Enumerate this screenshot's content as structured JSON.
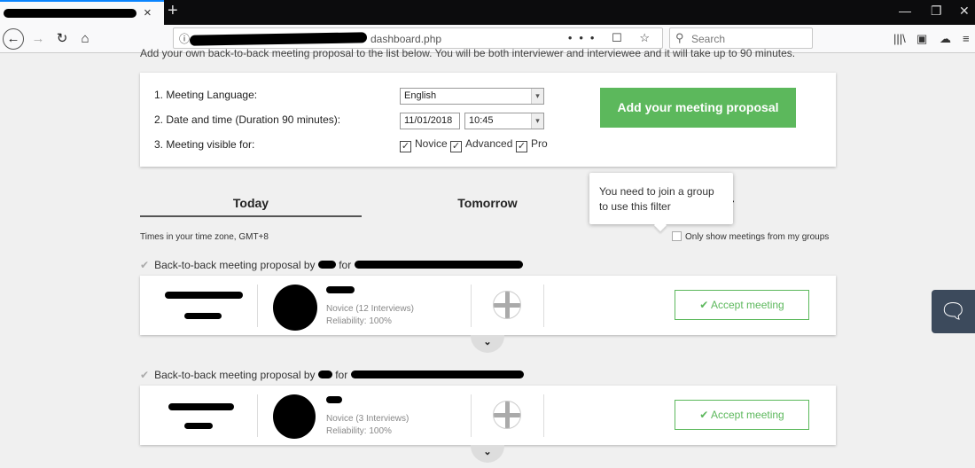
{
  "browser": {
    "tab_close": "×",
    "new_tab": "+",
    "url_suffix": "dashboard.php",
    "url_actions": "••• ☐ ☆",
    "search_placeholder": "Search"
  },
  "intro_text": "Add your own back-to-back meeting proposal to the list below. You will be both interviewer and interviewee and it will take up to 90 minutes.",
  "form": {
    "language_label": "1. Meeting Language:",
    "language_value": "English",
    "datetime_label": "2. Date and time (Duration 90 minutes):",
    "date_value": "11/01/2018",
    "time_value": "10:45",
    "visible_label": "3. Meeting visible for:",
    "levels": [
      "Novice",
      "Advanced",
      "Pro"
    ],
    "add_button": "Add your meeting proposal"
  },
  "tabs": [
    "Today",
    "Tomorrow",
    "er"
  ],
  "tooltip": "You need to join a group to use this filter",
  "timezone_note": "Times in your time zone, GMT+8",
  "group_filter_label": "Only show meetings from my groups",
  "meetings": [
    {
      "header_prefix": "Back-to-back meeting proposal by",
      "header_for": "for",
      "level": "Novice (12 Interviews)",
      "reliability": "Reliability: 100%",
      "accept": "Accept meeting"
    },
    {
      "header_prefix": "Back-to-back meeting proposal by",
      "header_for": "for",
      "level": "Novice (3 Interviews)",
      "reliability": "Reliability: 100%",
      "accept": "Accept meeting"
    }
  ],
  "colors": {
    "accent": "#5cb85c",
    "chat_bg": "#3c4a5c"
  }
}
